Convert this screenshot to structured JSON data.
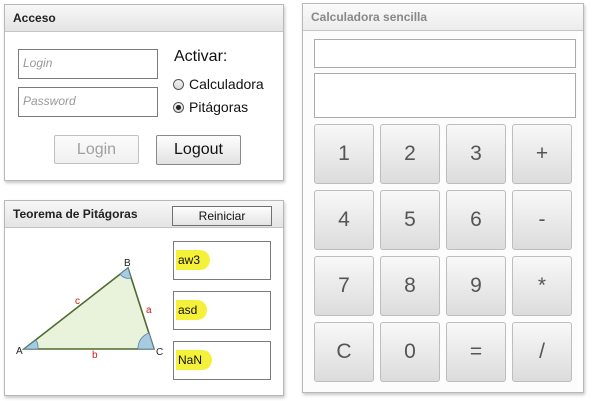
{
  "acceso": {
    "title": "Acceso",
    "login_placeholder": "Login",
    "password_placeholder": "Password",
    "activar_label": "Activar:",
    "options": [
      {
        "label": "Calculadora",
        "checked": false
      },
      {
        "label": "Pitágoras",
        "checked": true
      }
    ],
    "login_button": "Login",
    "logout_button": "Logout"
  },
  "teorema": {
    "title": "Teorema de Pitágoras",
    "reset_button": "Reiniciar",
    "triangle": {
      "vertex_a": "A",
      "vertex_b": "B",
      "vertex_c": "C",
      "side_a": "a",
      "side_b": "b",
      "side_c": "c"
    },
    "values": [
      "aw3",
      "asd",
      "NaN"
    ],
    "highlight_color": "#f5f03a"
  },
  "calculadora": {
    "title": "Calculadora sencilla",
    "keys": [
      [
        "1",
        "2",
        "3",
        "+"
      ],
      [
        "4",
        "5",
        "6",
        "-"
      ],
      [
        "7",
        "8",
        "9",
        "*"
      ],
      [
        "C",
        "0",
        "=",
        "/"
      ]
    ]
  }
}
